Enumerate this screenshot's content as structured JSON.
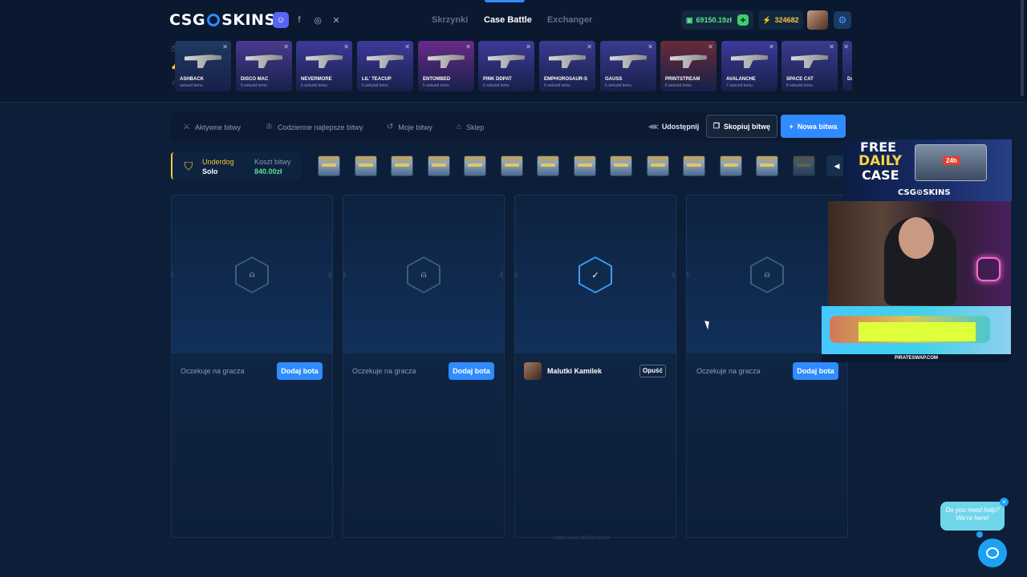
{
  "brand": {
    "logo_left": "CSG",
    "logo_right": "SKINS"
  },
  "nav": {
    "items": [
      "Skrzynki",
      "Case Battle",
      "Exchanger"
    ],
    "active": "Case Battle"
  },
  "account": {
    "balance": "69150.19zł",
    "coins": "324682"
  },
  "feed": {
    "items": [
      {
        "name": "ASHBACK",
        "sub": "sekund temu",
        "color": "#1f3a5f"
      },
      {
        "name": "DISCO MAC",
        "sub": "5 sekund temu",
        "color": "#4a3a8f"
      },
      {
        "name": "NEVERMORE",
        "sub": "5 sekund temu",
        "color": "#3d3a9a"
      },
      {
        "name": "LIL' TEACUP",
        "sub": "5 sekund temu",
        "color": "#3f3a9c"
      },
      {
        "name": "ENTOMBED",
        "sub": "5 sekund temu",
        "color": "#6a2a8a"
      },
      {
        "name": "PINK DDPAT",
        "sub": "6 sekund temu",
        "color": "#3d3a9a"
      },
      {
        "name": "EMPHOROSAUR-S",
        "sub": "6 sekund temu",
        "color": "#3a3b8f"
      },
      {
        "name": "GAUSS",
        "sub": "6 sekund temu",
        "color": "#3a3b8f"
      },
      {
        "name": "PRINTSTREAM",
        "sub": "6 sekund temu",
        "color": "#6a2a3a"
      },
      {
        "name": "AVALANCHE",
        "sub": "7 sekund temu",
        "color": "#3d3a9a"
      },
      {
        "name": "SPACE CAT",
        "sub": "8 sekund temu",
        "color": "#3a3b8f"
      },
      {
        "name": "DA",
        "sub": "",
        "color": "#3a3b8f"
      }
    ]
  },
  "tabs": {
    "items": [
      "Aktywne bitwy",
      "Codzienne najlepsze bitwy",
      "Moje bitwy",
      "Sklep"
    ],
    "share": "Udostępnij",
    "copy": "Skopiuj bitwę",
    "new": "Nowa bitwa"
  },
  "battle": {
    "mode_title": "Underdog",
    "mode_sub": "Solo",
    "cost_title": "Koszt bitwy",
    "cost_value": "840.00zł"
  },
  "slots": [
    {
      "status": "Oczekuje na gracza",
      "action": "Dodaj bota"
    },
    {
      "status": "Oczekuje na gracza",
      "action": "Dodaj bota"
    },
    {
      "player": "Malutki Kamilek",
      "action": "Opuść"
    },
    {
      "status": "Oczekuje na gracza",
      "action": "Dodaj bota"
    }
  ],
  "seed": "Client seed: 4fD0eu7ke89",
  "promo": {
    "free": "FREE",
    "daily": "DAILY",
    "case": "CASE",
    "badge": "24h",
    "logo": "CSG⊙SKINS"
  },
  "ad": {
    "label": "PIRATESWAP.COM"
  },
  "help": {
    "text": "Do you need help? We're here!"
  }
}
